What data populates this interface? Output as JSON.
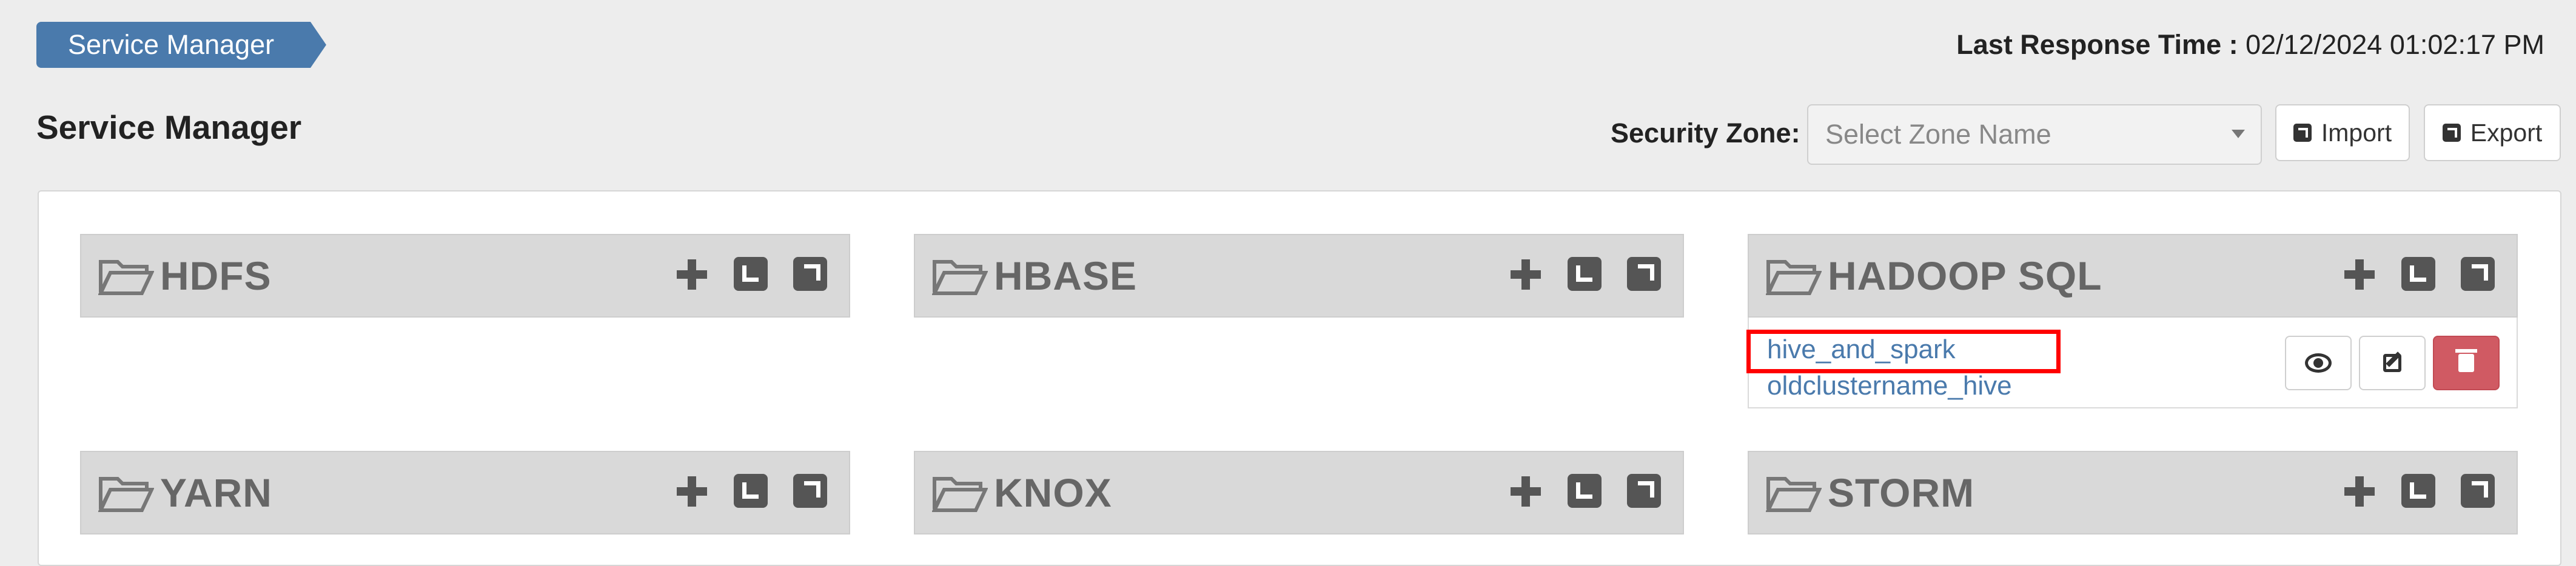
{
  "breadcrumb": {
    "label": "Service Manager"
  },
  "last_response": {
    "label": "Last Response Time :",
    "value": "02/12/2024 01:02:17 PM"
  },
  "page_title": "Service Manager",
  "zone": {
    "label": "Security Zone:",
    "placeholder": "Select Zone Name"
  },
  "toolbar": {
    "import_label": "Import",
    "export_label": "Export"
  },
  "services": [
    {
      "name": "HDFS",
      "items": []
    },
    {
      "name": "HBASE",
      "items": []
    },
    {
      "name": "HADOOP SQL",
      "items": [
        "hive_and_spark",
        "oldclustername_hive"
      ]
    },
    {
      "name": "YARN",
      "items": []
    },
    {
      "name": "KNOX",
      "items": []
    },
    {
      "name": "STORM",
      "items": []
    }
  ],
  "colors": {
    "accent": "#4a7aac",
    "delete": "#d05a63",
    "panel_header": "#d9d9d9",
    "highlight": "#ff0000"
  },
  "icons": [
    "folder-open-icon",
    "plus-icon",
    "edit-icon",
    "external-link-icon",
    "eye-icon",
    "pencil-icon",
    "trash-icon"
  ]
}
